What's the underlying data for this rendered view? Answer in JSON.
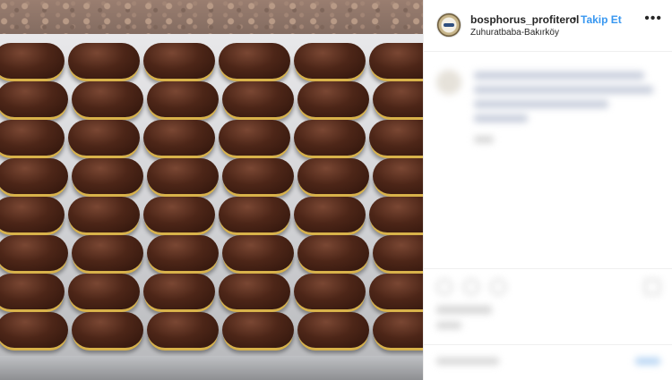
{
  "post": {
    "username": "bosphorus_profiterol",
    "separator": "•",
    "follow_label": "Takip Et",
    "location": "Zuhuratbaba-Bakırköy",
    "more_icon": "more-options-icon",
    "more_glyph": "•••"
  },
  "photo": {
    "subject": "chocolate-glazed eclairs on a tray"
  },
  "colors": {
    "accent": "#3897f0",
    "text": "#262626",
    "border": "#efefef"
  }
}
